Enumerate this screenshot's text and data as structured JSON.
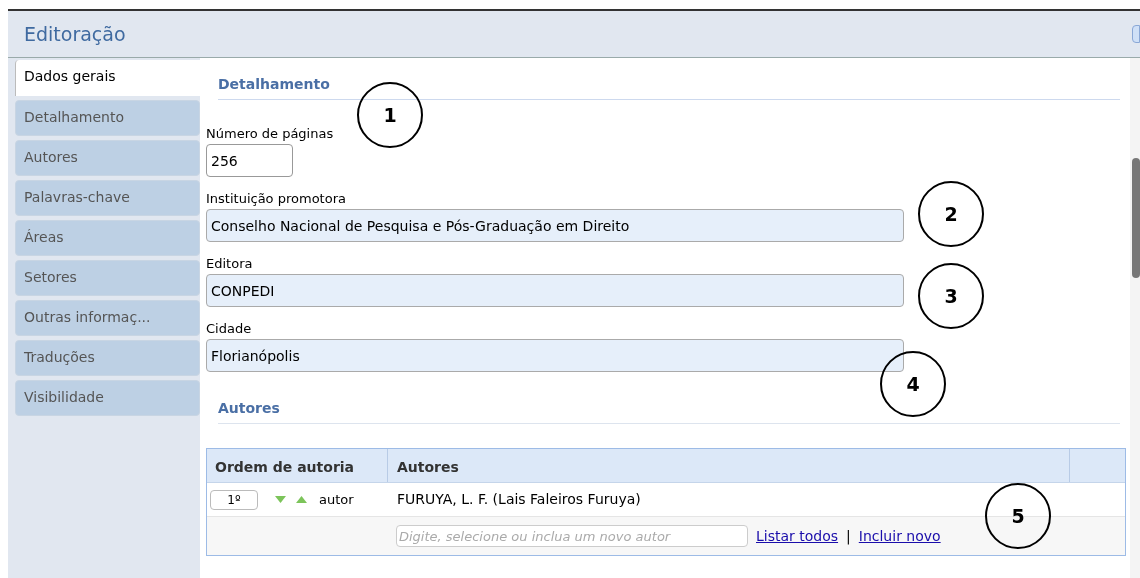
{
  "window": {
    "title": "Editoração"
  },
  "tabs": [
    {
      "label": "Dados gerais",
      "selected": true
    },
    {
      "label": "Detalhamento",
      "selected": false
    },
    {
      "label": "Autores",
      "selected": false
    },
    {
      "label": "Palavras-chave",
      "selected": false
    },
    {
      "label": "Áreas",
      "selected": false
    },
    {
      "label": "Setores",
      "selected": false
    },
    {
      "label": "Outras informaç...",
      "selected": false
    },
    {
      "label": "Traduções",
      "selected": false
    },
    {
      "label": "Visibilidade",
      "selected": false
    }
  ],
  "detalhamento": {
    "heading": "Detalhamento",
    "fields": [
      {
        "label": "Número de páginas",
        "value": "256",
        "kind": "short"
      },
      {
        "label": "Instituição promotora",
        "value": "Conselho Nacional de Pesquisa e Pós-Graduação em Direito",
        "kind": "wide"
      },
      {
        "label": "Editora",
        "value": "CONPEDI",
        "kind": "wide"
      },
      {
        "label": "Cidade",
        "value": "Florianópolis",
        "kind": "wide"
      }
    ]
  },
  "autores": {
    "heading": "Autores",
    "columns": [
      "Ordem de autoria",
      "Autores"
    ],
    "rows": [
      {
        "order": "1º",
        "role": "autor",
        "name": "FURUYA, L. F. (Lais Faleiros Furuya)"
      }
    ],
    "search": {
      "placeholder": "Digite, selecione ou inclua um novo autor"
    },
    "links": [
      "Listar todos",
      "Incluir novo"
    ],
    "separator": "|"
  },
  "callouts": [
    "1",
    "2",
    "3",
    "4",
    "5"
  ]
}
